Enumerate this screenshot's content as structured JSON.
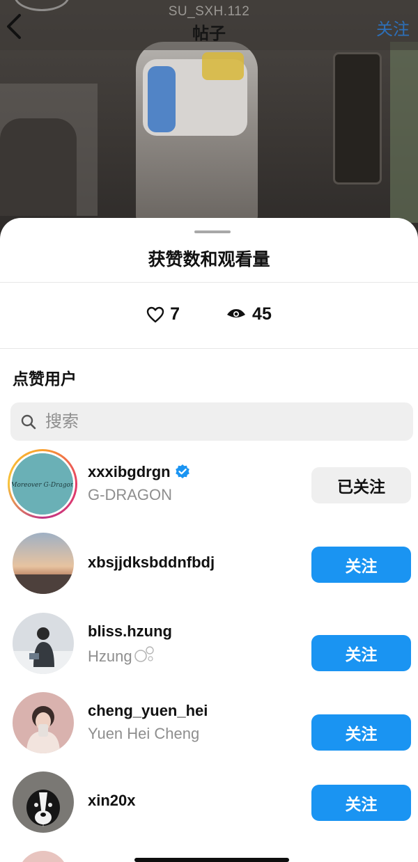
{
  "header": {
    "username": "SU_SXH.112",
    "title": "帖子",
    "follow_label": "关注"
  },
  "sheet": {
    "title": "获赞数和观看量",
    "likes_count": "7",
    "views_count": "45",
    "section_title": "点赞用户",
    "search_placeholder": "搜索"
  },
  "users": [
    {
      "username": "xxxibgdrgn",
      "full_name": "G-DRAGON",
      "verified": true,
      "has_story_ring": true,
      "button_label": "已关注",
      "button_state": "following"
    },
    {
      "username": "xbsjjdksbddnfbdj",
      "full_name": "",
      "verified": false,
      "has_story_ring": false,
      "button_label": "关注",
      "button_state": "follow"
    },
    {
      "username": "bliss.hzung",
      "full_name": "Hzung",
      "verified": false,
      "has_story_ring": false,
      "button_label": "关注",
      "button_state": "follow"
    },
    {
      "username": "cheng_yuen_hei",
      "full_name": "Yuen Hei Cheng",
      "verified": false,
      "has_story_ring": false,
      "button_label": "关注",
      "button_state": "follow"
    },
    {
      "username": "xin20x",
      "full_name": "",
      "verified": false,
      "has_story_ring": false,
      "button_label": "关注",
      "button_state": "follow"
    }
  ],
  "avatar_logo_text": "Moreover G-Dragon",
  "colors": {
    "follow_button": "#1a94f2",
    "following_button": "#efefef",
    "verified_badge": "#1a94f2",
    "header_follow": "#2d6fb8"
  }
}
